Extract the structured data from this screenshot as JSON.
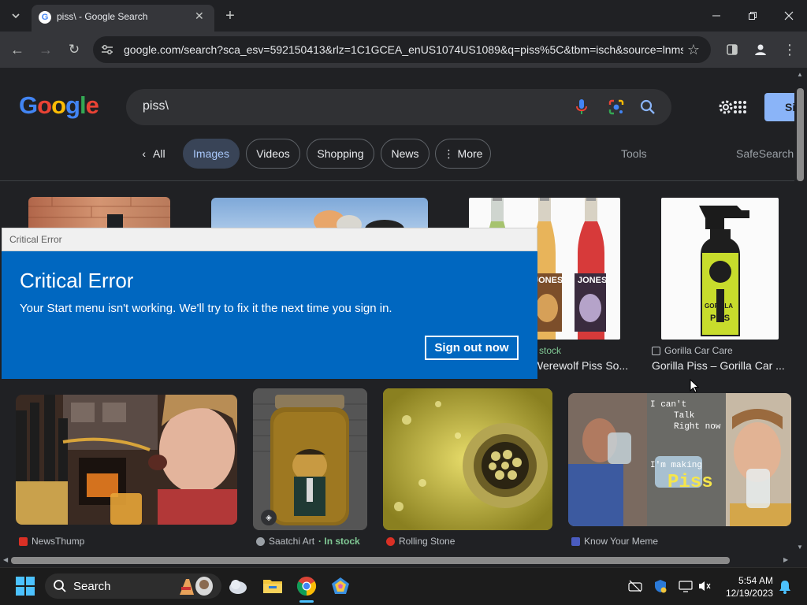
{
  "browser": {
    "tab_title": "piss\\ - Google Search",
    "url": "google.com/search?sca_esv=592150413&rlz=1C1GCEA_enUS1074US1089&q=piss%5C&tbm=isch&source=lnms..."
  },
  "google": {
    "logo": [
      "G",
      "o",
      "o",
      "g",
      "l",
      "e"
    ],
    "logo_colors": [
      "#4285f4",
      "#ea4335",
      "#fbbc05",
      "#4285f4",
      "#34a853",
      "#ea4335"
    ],
    "query": "piss\\",
    "signin_label": "Si",
    "tabs": {
      "all": "All",
      "images": "Images",
      "videos": "Videos",
      "shopping": "Shopping",
      "news": "News",
      "more": "More"
    },
    "tools_label": "Tools",
    "safesearch_label": "SafeSearch"
  },
  "results_row1": [
    {
      "source": "stock",
      "title": "Werewolf Piss So..."
    },
    {
      "source": "Gorilla Car Care",
      "title": "Gorilla Piss – Gorilla Car ..."
    }
  ],
  "results_row2": [
    {
      "source": "NewsThump",
      "source_color": "#d93025"
    },
    {
      "source": "Saatchi Art",
      "extra": "· In stock",
      "source_color": "#9aa0a6"
    },
    {
      "source": "Rolling Stone",
      "source_color": "#d93025"
    },
    {
      "source": "Know Your Meme",
      "source_color": "#4a5cc0"
    }
  ],
  "meme_text": {
    "line1": "I can't",
    "line2": "Talk",
    "line3": "Right now",
    "line4": "I'm making",
    "line5": "Piss"
  },
  "jar_text": "JONES",
  "gorilla_text": "GORILLA PISS",
  "dialog": {
    "bar_title": "Critical Error",
    "heading": "Critical Error",
    "message": "Your Start menu isn't working. We'll try to fix it the next time you sign in.",
    "button": "Sign out now"
  },
  "taskbar": {
    "search_label": "Search",
    "time": "5:54 AM",
    "date": "12/19/2023"
  }
}
